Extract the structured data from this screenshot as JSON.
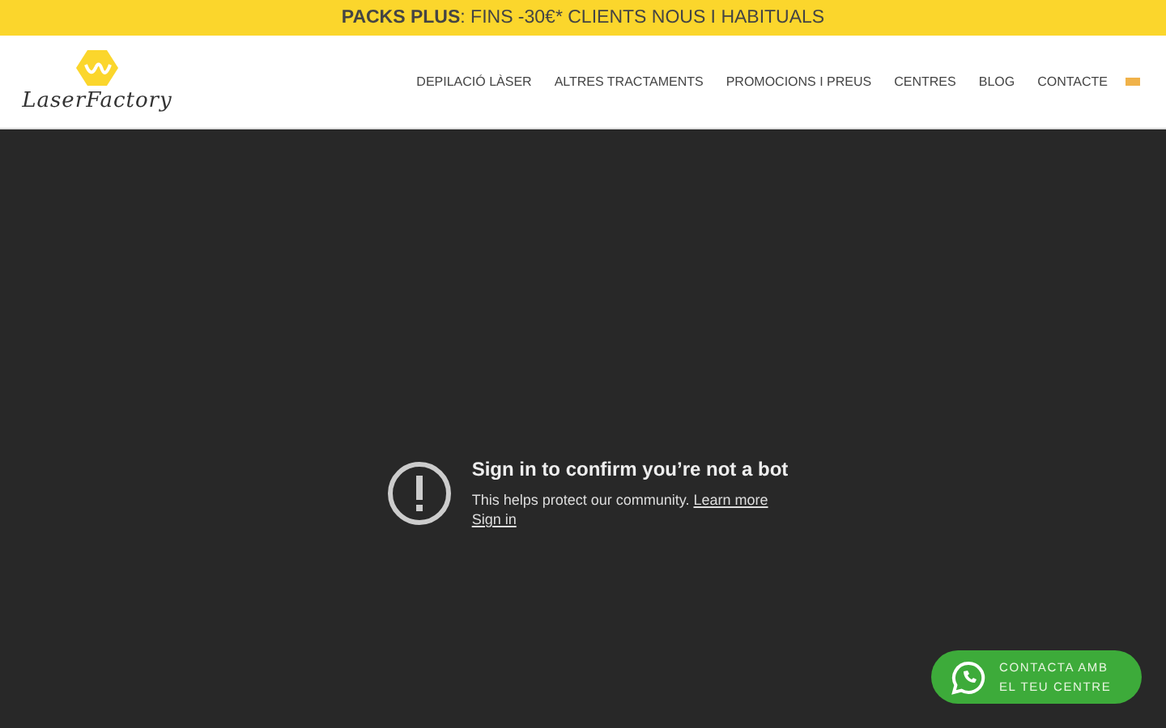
{
  "banner": {
    "text": "**PACKS PLUS**: FINS -30€* CLIENTS NOUS I HABITUALS"
  },
  "header": {
    "logo_text": "LaserFactory",
    "nav": [
      {
        "label": "DEPILACIÓ LÀSER"
      },
      {
        "label": "ALTRES TRACTAMENTS"
      },
      {
        "label": "PROMOCIONS I PREUS"
      },
      {
        "label": "CENTRES"
      },
      {
        "label": "BLOG"
      },
      {
        "label": "CONTACTE"
      }
    ]
  },
  "video": {
    "title": "Sign in to confirm you’re not a bot",
    "message": "This helps protect our community.",
    "learn_more": "Learn more",
    "sign_in": "Sign in"
  },
  "whatsapp": {
    "lines": [
      "CONTACTA AMB",
      "EL TEU CENTRE"
    ]
  }
}
